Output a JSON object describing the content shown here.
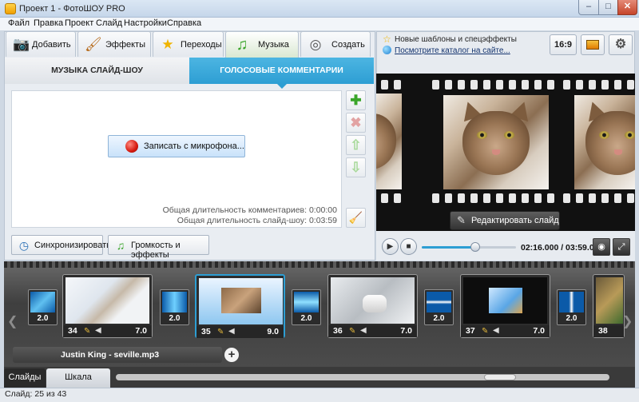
{
  "window": {
    "title": "Проект 1 - ФотоШОУ PRO",
    "btn_min": "–",
    "btn_max": "□",
    "btn_close": "✕"
  },
  "menu": [
    "Файл",
    "Правка",
    "Проект",
    "Слайд",
    "Настройки",
    "Справка"
  ],
  "tabs": [
    {
      "label": "Добавить",
      "icon": "camera-icon",
      "glyph": "📷"
    },
    {
      "label": "Эффекты",
      "icon": "brush-icon",
      "glyph": "🖌"
    },
    {
      "label": "Переходы",
      "icon": "star-icon",
      "glyph": "★"
    },
    {
      "label": "Музыка",
      "icon": "music-note-icon",
      "glyph": "♫",
      "active": true
    },
    {
      "label": "Создать",
      "icon": "film-reel-icon",
      "glyph": "◎"
    }
  ],
  "subtabs": {
    "music": "МУЗЫКА СЛАЙД-ШОУ",
    "voice": "ГОЛОСОВЫЕ КОММЕНТАРИИ"
  },
  "record": {
    "label": "Записать с микрофона..."
  },
  "durations": {
    "comments": "Общая длительность комментариев: 0:00:00",
    "show": "Общая длительность слайд-шоу: 0:03:59"
  },
  "side_buttons": {
    "add": "✚",
    "delete": "✖",
    "up": "⇧",
    "down": "⇩",
    "clear": "🧹"
  },
  "bottom_buttons": {
    "sync": "Синхронизировать",
    "volume": "Громкость и эффекты"
  },
  "news": {
    "text": "Новые шаблоны и спецэффекты",
    "link": "Посмотрите каталог на сайте..."
  },
  "right_toolbar": {
    "aspect": "16:9",
    "bg_glyph": "▬",
    "settings_glyph": "⚙"
  },
  "preview": {
    "edit_label": "Редактировать слайд",
    "edit_glyph": "✎"
  },
  "player": {
    "time": "02:16.000 / 03:59.000",
    "progress": 0.57,
    "play": "▶",
    "stop": "■",
    "snapshot": "◉",
    "fullscreen": "⤢"
  },
  "slides": [
    {
      "num": "34",
      "dur": "7.0"
    },
    {
      "num": "35",
      "dur": "9.0"
    },
    {
      "num": "36",
      "dur": "7.0"
    },
    {
      "num": "37",
      "dur": "7.0"
    },
    {
      "num": "38",
      "dur": ""
    }
  ],
  "transitions": [
    "2.0",
    "2.0",
    "2.0",
    "2.0",
    "2.0"
  ],
  "audio": {
    "track": "Justin King - seville.mp3",
    "add": "+"
  },
  "bottom_tabs": {
    "slides": "Слайды",
    "timeline": "Шкала времени"
  },
  "status": "Слайд: 25 из 43",
  "colors": {
    "accent": "#2d9ed3",
    "record": "#d51a0f"
  }
}
